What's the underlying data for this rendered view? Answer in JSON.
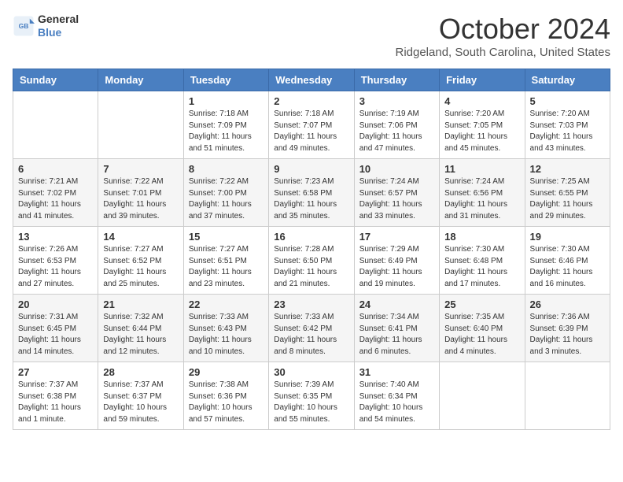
{
  "header": {
    "logo_line1": "General",
    "logo_line2": "Blue",
    "month": "October 2024",
    "location": "Ridgeland, South Carolina, United States"
  },
  "weekdays": [
    "Sunday",
    "Monday",
    "Tuesday",
    "Wednesday",
    "Thursday",
    "Friday",
    "Saturday"
  ],
  "weeks": [
    [
      {
        "day": "",
        "info": ""
      },
      {
        "day": "",
        "info": ""
      },
      {
        "day": "1",
        "info": "Sunrise: 7:18 AM\nSunset: 7:09 PM\nDaylight: 11 hours and 51 minutes."
      },
      {
        "day": "2",
        "info": "Sunrise: 7:18 AM\nSunset: 7:07 PM\nDaylight: 11 hours and 49 minutes."
      },
      {
        "day": "3",
        "info": "Sunrise: 7:19 AM\nSunset: 7:06 PM\nDaylight: 11 hours and 47 minutes."
      },
      {
        "day": "4",
        "info": "Sunrise: 7:20 AM\nSunset: 7:05 PM\nDaylight: 11 hours and 45 minutes."
      },
      {
        "day": "5",
        "info": "Sunrise: 7:20 AM\nSunset: 7:03 PM\nDaylight: 11 hours and 43 minutes."
      }
    ],
    [
      {
        "day": "6",
        "info": "Sunrise: 7:21 AM\nSunset: 7:02 PM\nDaylight: 11 hours and 41 minutes."
      },
      {
        "day": "7",
        "info": "Sunrise: 7:22 AM\nSunset: 7:01 PM\nDaylight: 11 hours and 39 minutes."
      },
      {
        "day": "8",
        "info": "Sunrise: 7:22 AM\nSunset: 7:00 PM\nDaylight: 11 hours and 37 minutes."
      },
      {
        "day": "9",
        "info": "Sunrise: 7:23 AM\nSunset: 6:58 PM\nDaylight: 11 hours and 35 minutes."
      },
      {
        "day": "10",
        "info": "Sunrise: 7:24 AM\nSunset: 6:57 PM\nDaylight: 11 hours and 33 minutes."
      },
      {
        "day": "11",
        "info": "Sunrise: 7:24 AM\nSunset: 6:56 PM\nDaylight: 11 hours and 31 minutes."
      },
      {
        "day": "12",
        "info": "Sunrise: 7:25 AM\nSunset: 6:55 PM\nDaylight: 11 hours and 29 minutes."
      }
    ],
    [
      {
        "day": "13",
        "info": "Sunrise: 7:26 AM\nSunset: 6:53 PM\nDaylight: 11 hours and 27 minutes."
      },
      {
        "day": "14",
        "info": "Sunrise: 7:27 AM\nSunset: 6:52 PM\nDaylight: 11 hours and 25 minutes."
      },
      {
        "day": "15",
        "info": "Sunrise: 7:27 AM\nSunset: 6:51 PM\nDaylight: 11 hours and 23 minutes."
      },
      {
        "day": "16",
        "info": "Sunrise: 7:28 AM\nSunset: 6:50 PM\nDaylight: 11 hours and 21 minutes."
      },
      {
        "day": "17",
        "info": "Sunrise: 7:29 AM\nSunset: 6:49 PM\nDaylight: 11 hours and 19 minutes."
      },
      {
        "day": "18",
        "info": "Sunrise: 7:30 AM\nSunset: 6:48 PM\nDaylight: 11 hours and 17 minutes."
      },
      {
        "day": "19",
        "info": "Sunrise: 7:30 AM\nSunset: 6:46 PM\nDaylight: 11 hours and 16 minutes."
      }
    ],
    [
      {
        "day": "20",
        "info": "Sunrise: 7:31 AM\nSunset: 6:45 PM\nDaylight: 11 hours and 14 minutes."
      },
      {
        "day": "21",
        "info": "Sunrise: 7:32 AM\nSunset: 6:44 PM\nDaylight: 11 hours and 12 minutes."
      },
      {
        "day": "22",
        "info": "Sunrise: 7:33 AM\nSunset: 6:43 PM\nDaylight: 11 hours and 10 minutes."
      },
      {
        "day": "23",
        "info": "Sunrise: 7:33 AM\nSunset: 6:42 PM\nDaylight: 11 hours and 8 minutes."
      },
      {
        "day": "24",
        "info": "Sunrise: 7:34 AM\nSunset: 6:41 PM\nDaylight: 11 hours and 6 minutes."
      },
      {
        "day": "25",
        "info": "Sunrise: 7:35 AM\nSunset: 6:40 PM\nDaylight: 11 hours and 4 minutes."
      },
      {
        "day": "26",
        "info": "Sunrise: 7:36 AM\nSunset: 6:39 PM\nDaylight: 11 hours and 3 minutes."
      }
    ],
    [
      {
        "day": "27",
        "info": "Sunrise: 7:37 AM\nSunset: 6:38 PM\nDaylight: 11 hours and 1 minute."
      },
      {
        "day": "28",
        "info": "Sunrise: 7:37 AM\nSunset: 6:37 PM\nDaylight: 10 hours and 59 minutes."
      },
      {
        "day": "29",
        "info": "Sunrise: 7:38 AM\nSunset: 6:36 PM\nDaylight: 10 hours and 57 minutes."
      },
      {
        "day": "30",
        "info": "Sunrise: 7:39 AM\nSunset: 6:35 PM\nDaylight: 10 hours and 55 minutes."
      },
      {
        "day": "31",
        "info": "Sunrise: 7:40 AM\nSunset: 6:34 PM\nDaylight: 10 hours and 54 minutes."
      },
      {
        "day": "",
        "info": ""
      },
      {
        "day": "",
        "info": ""
      }
    ]
  ]
}
